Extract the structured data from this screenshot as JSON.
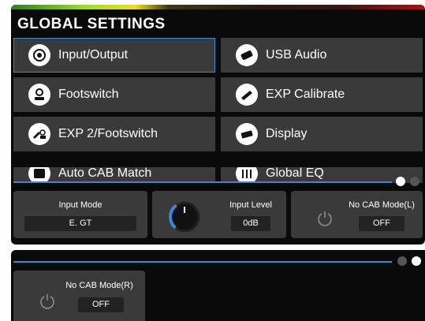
{
  "header": {
    "title": "GLOBAL SETTINGS"
  },
  "menu": [
    {
      "label": "Input/Output",
      "icon": "input-output-icon",
      "selected": true
    },
    {
      "label": "USB Audio",
      "icon": "usb-audio-icon",
      "selected": false
    },
    {
      "label": "Footswitch",
      "icon": "footswitch-icon",
      "selected": false
    },
    {
      "label": "EXP Calibrate",
      "icon": "exp-calibrate-icon",
      "selected": false
    },
    {
      "label": "EXP 2/Footswitch",
      "icon": "exp2-footswitch-icon",
      "selected": false
    },
    {
      "label": "Display",
      "icon": "display-icon",
      "selected": false
    },
    {
      "label": "Auto CAB Match",
      "icon": "auto-cab-match-icon",
      "selected": false
    },
    {
      "label": "Global EQ",
      "icon": "global-eq-icon",
      "selected": false
    }
  ],
  "params_page1": {
    "input_mode": {
      "label": "Input Mode",
      "value": "E. GT"
    },
    "input_level": {
      "label": "Input Level",
      "value": "0dB",
      "level": 0.35
    },
    "no_cab_left": {
      "label": "No CAB Mode(L)",
      "value": "OFF"
    }
  },
  "params_page2": {
    "no_cab_right": {
      "label": "No CAB Mode(R)",
      "value": "OFF"
    }
  },
  "colors": {
    "accent": "#3f86d8",
    "panel": "#0a0a0a",
    "button": "#3a3a3a"
  }
}
